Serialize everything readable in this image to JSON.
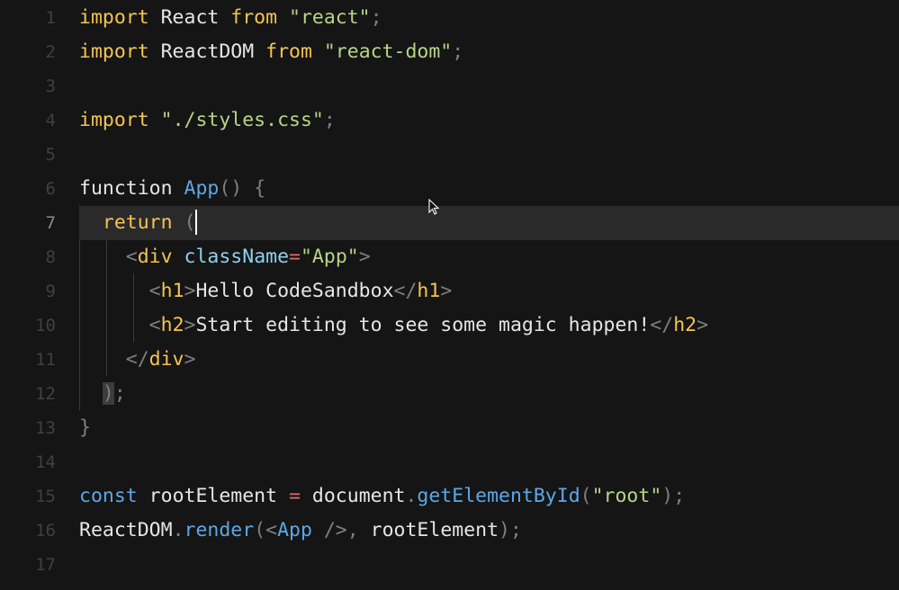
{
  "lines": [
    {
      "num": "1",
      "tokens": [
        [
          "kw",
          "import"
        ],
        [
          "plain",
          " React "
        ],
        [
          "kw",
          "from"
        ],
        [
          "plain",
          " "
        ],
        [
          "str",
          "\"react\""
        ],
        [
          "punct",
          ";"
        ]
      ]
    },
    {
      "num": "2",
      "tokens": [
        [
          "kw",
          "import"
        ],
        [
          "plain",
          " ReactDOM "
        ],
        [
          "kw",
          "from"
        ],
        [
          "plain",
          " "
        ],
        [
          "str",
          "\"react-dom\""
        ],
        [
          "punct",
          ";"
        ]
      ]
    },
    {
      "num": "3",
      "tokens": []
    },
    {
      "num": "4",
      "tokens": [
        [
          "kw",
          "import"
        ],
        [
          "plain",
          " "
        ],
        [
          "str",
          "\"./styles.css\""
        ],
        [
          "punct",
          ";"
        ]
      ]
    },
    {
      "num": "5",
      "tokens": []
    },
    {
      "num": "6",
      "tokens": [
        [
          "plain",
          "function "
        ],
        [
          "fn",
          "App"
        ],
        [
          "punct",
          "() {"
        ]
      ]
    },
    {
      "num": "7",
      "tokens": [
        [
          "plain",
          "  "
        ],
        [
          "kw",
          "return"
        ],
        [
          "plain",
          " "
        ],
        [
          "punct",
          "("
        ]
      ]
    },
    {
      "num": "8",
      "tokens": [
        [
          "plain",
          "    "
        ],
        [
          "punct",
          "<"
        ],
        [
          "tag",
          "div"
        ],
        [
          "plain",
          " "
        ],
        [
          "attr",
          "className"
        ],
        [
          "eq",
          "="
        ],
        [
          "str",
          "\"App\""
        ],
        [
          "punct",
          ">"
        ]
      ]
    },
    {
      "num": "9",
      "tokens": [
        [
          "plain",
          "      "
        ],
        [
          "punct",
          "<"
        ],
        [
          "tag",
          "h1"
        ],
        [
          "punct",
          ">"
        ],
        [
          "plain",
          "Hello CodeSandbox"
        ],
        [
          "punct",
          "</"
        ],
        [
          "tag",
          "h1"
        ],
        [
          "punct",
          ">"
        ]
      ]
    },
    {
      "num": "10",
      "tokens": [
        [
          "plain",
          "      "
        ],
        [
          "punct",
          "<"
        ],
        [
          "tag",
          "h2"
        ],
        [
          "punct",
          ">"
        ],
        [
          "plain",
          "Start editing to see some magic happen!"
        ],
        [
          "punct",
          "</"
        ],
        [
          "tag",
          "h2"
        ],
        [
          "punct",
          ">"
        ]
      ]
    },
    {
      "num": "11",
      "tokens": [
        [
          "plain",
          "    "
        ],
        [
          "punct",
          "</"
        ],
        [
          "tag",
          "div"
        ],
        [
          "punct",
          ">"
        ]
      ]
    },
    {
      "num": "12",
      "tokens": [
        [
          "plain",
          "  "
        ],
        [
          "punct",
          ")"
        ],
        [
          "punct",
          ";"
        ]
      ]
    },
    {
      "num": "13",
      "tokens": [
        [
          "punct",
          "}"
        ]
      ]
    },
    {
      "num": "14",
      "tokens": []
    },
    {
      "num": "15",
      "tokens": [
        [
          "fn",
          "const"
        ],
        [
          "plain",
          " rootElement "
        ],
        [
          "op",
          "="
        ],
        [
          "plain",
          " document"
        ],
        [
          "punct",
          "."
        ],
        [
          "fn",
          "getElementById"
        ],
        [
          "punct",
          "("
        ],
        [
          "str",
          "\"root\""
        ],
        [
          "punct",
          ");"
        ]
      ]
    },
    {
      "num": "16",
      "tokens": [
        [
          "plain",
          "ReactDOM"
        ],
        [
          "punct",
          "."
        ],
        [
          "fn",
          "render"
        ],
        [
          "punct",
          "(<"
        ],
        [
          "fn",
          "App"
        ],
        [
          "punct",
          " />, "
        ],
        [
          "plain",
          "rootElement"
        ],
        [
          "punct",
          ");"
        ]
      ]
    },
    {
      "num": "17",
      "tokens": []
    }
  ],
  "active_line": 7,
  "colors": {
    "background": "#151515",
    "keyword": "#f5c451",
    "string": "#b8d487",
    "function": "#5ea7e6",
    "attribute": "#8fd0f0"
  },
  "cursor_icon": "mouse-pointer-icon"
}
